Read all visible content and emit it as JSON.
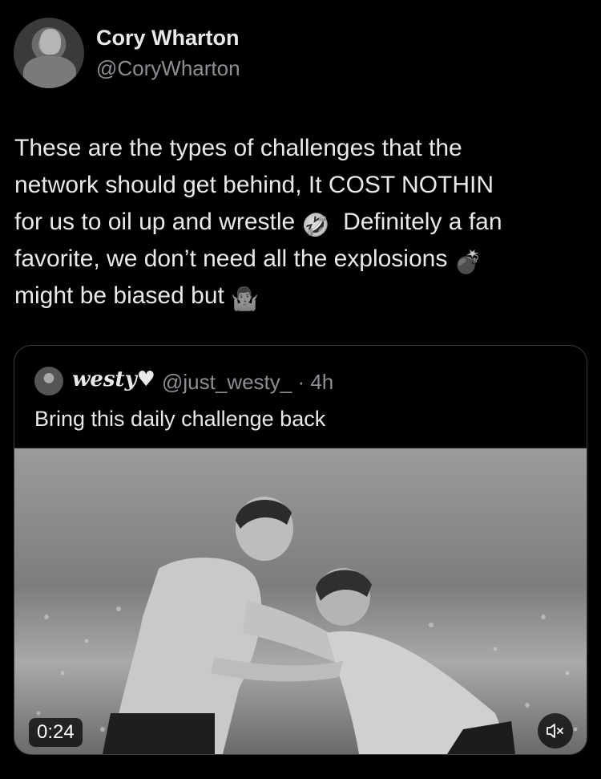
{
  "tweet": {
    "author": {
      "name": "Cory Wharton",
      "handle": "@CoryWharton"
    },
    "text_lines": [
      "These are the types of challenges that the",
      "network should get behind, It COST NOTHIN",
      "for us to oil up and wrestle",
      "Definitely a fan",
      "favorite, we don’t need all the explosions",
      "might be biased but"
    ],
    "emojis": {
      "rofl": "🤣",
      "bomb": "💣",
      "shrug": "🤷🏽‍♂️"
    }
  },
  "quote": {
    "author_name": "westy♥",
    "meta": "@just_westy_ · 4h",
    "text": "Bring this daily challenge back",
    "video": {
      "duration": "0:24",
      "muted": true
    }
  }
}
